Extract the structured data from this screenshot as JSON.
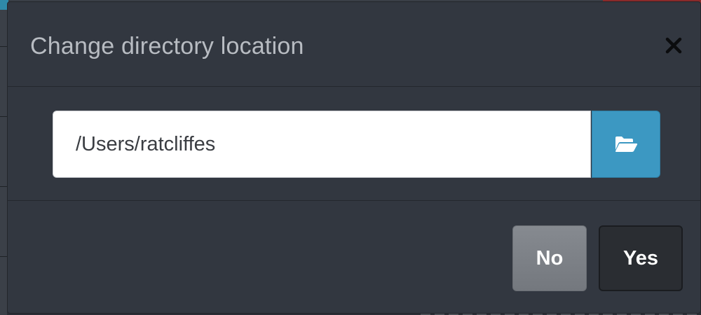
{
  "dialog": {
    "title": "Change directory location",
    "close_icon": "close-icon"
  },
  "directory": {
    "value": "/Users/ratcliffes",
    "browse_icon": "folder-open-icon"
  },
  "footer": {
    "no_label": "No",
    "yes_label": "Yes"
  },
  "colors": {
    "modal_bg": "#323740",
    "title_text": "#b8bcc2",
    "browse_button": "#3c98c2",
    "no_button": "#7d8187",
    "yes_button": "#2a2d32"
  }
}
